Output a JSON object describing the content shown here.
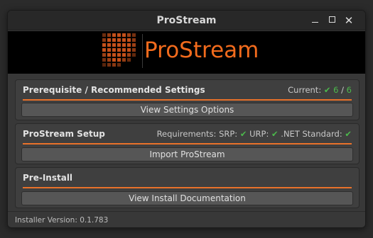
{
  "window": {
    "title": "ProStream"
  },
  "banner": {
    "logo_text": "ProStream",
    "accent_color": "#f26b1d"
  },
  "panels": [
    {
      "title": "Prerequisite / Recommended Settings",
      "status_label": "Current:",
      "status_value": "6",
      "status_sep": "/",
      "status_total": "6",
      "button_label": "View Settings Options"
    },
    {
      "title": "ProStream Setup",
      "requirements_label": "Requirements:",
      "requirements": [
        {
          "label": "SRP:",
          "ok": true
        },
        {
          "label": "URP:",
          "ok": true
        },
        {
          "label": ".NET Standard:",
          "ok": true
        }
      ],
      "button_label": "Import ProStream"
    },
    {
      "title": "Pre-Install",
      "button_label": "View Install Documentation"
    }
  ],
  "check_glyph": "✔",
  "footer": {
    "version_text": "Installer Version: 0.1.783"
  },
  "colors": {
    "accent": "#e8712a",
    "success": "#4cb84c",
    "window_bg": "#383838"
  }
}
